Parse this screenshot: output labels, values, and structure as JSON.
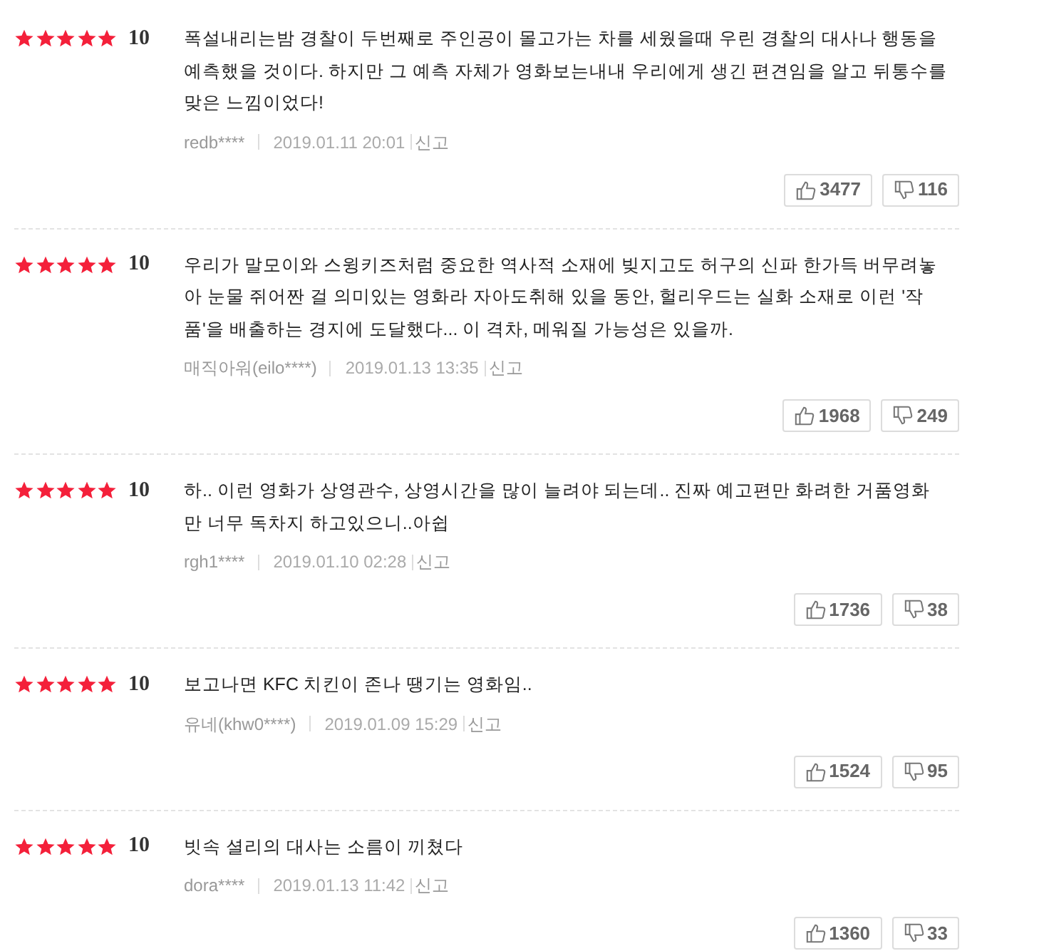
{
  "reviews": [
    {
      "stars": 5,
      "score": "10",
      "text": "폭설내리는밤 경찰이 두번째로 주인공이 몰고가는 차를 세웠을때 우린 경찰의 대사나 행동을 예측했을 것이다. 하지만 그 예측 자체가 영화보는내내 우리에게 생긴 편견임을 알고 뒤통수를 맞은 느낌이었다!",
      "author": "redb****",
      "date": "2019.01.11 20:01",
      "report": "신고",
      "likes": "3477",
      "dislikes": "116"
    },
    {
      "stars": 5,
      "score": "10",
      "text": "우리가 말모이와 스윙키즈처럼 중요한 역사적 소재에 빚지고도 허구의 신파 한가득 버무려놓아 눈물 쥐어짠 걸 의미있는 영화라 자아도취해 있을 동안, 헐리우드는 실화 소재로 이런 '작품'을 배출하는 경지에 도달했다... 이 격차, 메워질 가능성은 있을까.",
      "author": "매직아워(eilo****)",
      "date": "2019.01.13 13:35",
      "report": "신고",
      "likes": "1968",
      "dislikes": "249"
    },
    {
      "stars": 5,
      "score": "10",
      "text": "하.. 이런 영화가 상영관수, 상영시간을 많이 늘려야 되는데.. 진짜 예고편만 화려한 거품영화만 너무 독차지 하고있으니..아쉽",
      "author": "rgh1****",
      "date": "2019.01.10 02:28",
      "report": "신고",
      "likes": "1736",
      "dislikes": "38"
    },
    {
      "stars": 5,
      "score": "10",
      "text": "보고나면 KFC 치킨이 존나 땡기는 영화임..",
      "author": "유네(khw0****)",
      "date": "2019.01.09 15:29",
      "report": "신고",
      "likes": "1524",
      "dislikes": "95"
    },
    {
      "stars": 5,
      "score": "10",
      "text": "빗속 셜리의 대사는 소름이 끼쳤다",
      "author": "dora****",
      "date": "2019.01.13 11:42",
      "report": "신고",
      "likes": "1360",
      "dislikes": "33"
    }
  ]
}
